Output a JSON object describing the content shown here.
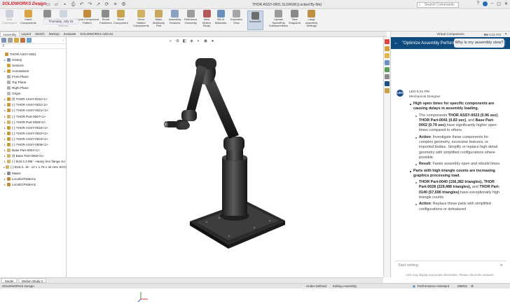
{
  "app": {
    "logo": "SOLIDWORKS Design",
    "doc_title": "THOR ASSY-0001.SLDASM [Locked By Me]",
    "search_placeholder": "Search Commands"
  },
  "title_icons": [
    "home-icon",
    "new-file-icon",
    "open-file-icon",
    "save-icon",
    "print-icon",
    "undo-icon",
    "redo-icon",
    "select-icon",
    "rebuild-icon",
    "file-properties-icon",
    "options-icon"
  ],
  "ribbon": [
    {
      "label": "Edit\nComponent",
      "icon": "edit-component-icon",
      "color": "#9aa9c3",
      "dim": true
    },
    {
      "label": "Insert\nComponents",
      "icon": "insert-components-icon",
      "color": "#d9a441"
    },
    {
      "label": "Mate",
      "icon": "mate-icon",
      "color": "#8d8d8d"
    },
    {
      "label": "Component\nPreview\nWindow",
      "icon": "component-preview-icon",
      "color": "#9fb4cc",
      "dim": true
    },
    {
      "label": "Linear Component\nPattern",
      "icon": "linear-pattern-icon",
      "color": "#c28c3a"
    },
    {
      "label": "Smart\nFasteners",
      "icon": "smart-fasteners-icon",
      "color": "#8b8b8b"
    },
    {
      "label": "Move\nComponent",
      "icon": "move-component-icon",
      "color": "#c9a34b"
    },
    {
      "label": "Show\nHidden\nComponents",
      "icon": "show-hidden-icon",
      "color": "#d2b062"
    },
    {
      "label": "Make\nMultibody\nPart",
      "icon": "multibody-part-icon",
      "color": "#c8a85c"
    },
    {
      "label": "Assembly\nFeatures",
      "icon": "assembly-features-icon",
      "color": "#8aa2c0"
    },
    {
      "label": "Reference\nGeometry",
      "icon": "reference-geometry-icon",
      "color": "#9c9c9c"
    },
    {
      "label": "New\nMotion\nStudy",
      "icon": "motion-study-icon",
      "color": "#b35b5b"
    },
    {
      "label": "Bill of\nMaterials",
      "icon": "bom-icon",
      "color": "#6d8fbf"
    },
    {
      "label": "Exploded\nView",
      "icon": "exploded-view-icon",
      "color": "#a6a6a6"
    },
    {
      "label": "Instant3D",
      "icon": "instant3d-icon",
      "color": "#6d6d6d",
      "active": true
    },
    {
      "label": "Update\nSpeedPak\nSubassemblies",
      "icon": "speedpak-icon",
      "color": "#9b9b9b"
    },
    {
      "label": "Take\nSnapshot",
      "icon": "snapshot-icon",
      "color": "#8a8a8a"
    },
    {
      "label": "Large\nAssembly\nSettings",
      "icon": "large-assembly-icon",
      "color": "#bf8f42"
    }
  ],
  "tabs": [
    "Assembly",
    "Layout",
    "Sketch",
    "Markup",
    "Evaluate",
    "SOLIDWORKS Add-Ins"
  ],
  "feature_tree": [
    {
      "label": "THOR ASSY-0001",
      "indent": 0,
      "arrow": "",
      "color": "#c79b3a"
    },
    {
      "label": "History",
      "indent": 1,
      "arrow": "▸",
      "color": "#7a93b5"
    },
    {
      "label": "Sensors",
      "indent": 1,
      "arrow": "",
      "color": "#d4a030"
    },
    {
      "label": "Annotations",
      "indent": 1,
      "arrow": "▸",
      "color": "#cf9d2a"
    },
    {
      "label": "Front Plane",
      "indent": 1,
      "arrow": "",
      "color": "#b0b0b0"
    },
    {
      "label": "Top Plane",
      "indent": 1,
      "arrow": "",
      "color": "#b0b0b0"
    },
    {
      "label": "Right Plane",
      "indent": 1,
      "arrow": "",
      "color": "#b0b0b0"
    },
    {
      "label": "Origin",
      "indent": 1,
      "arrow": "",
      "color": "#b8b8b8"
    },
    {
      "label": "(f) THOR ASSY-0011<1>",
      "indent": 1,
      "arrow": "▸",
      "color": "#c79b3a"
    },
    {
      "label": "(-) THOR ASSY-0011<2>",
      "indent": 1,
      "arrow": "▸",
      "color": "#c79b3a"
    },
    {
      "label": "(-) THOR ASSY-0021<1>",
      "indent": 1,
      "arrow": "▸",
      "color": "#c79b3a"
    },
    {
      "label": "(-) THOR Part-0007<1>",
      "indent": 1,
      "arrow": "▸",
      "color": "#d3b16a"
    },
    {
      "label": "(-) THOR Part-0050<2>",
      "indent": 1,
      "arrow": "▸",
      "color": "#d3b16a"
    },
    {
      "label": "(-) THOR ASSY-0015<1>",
      "indent": 1,
      "arrow": "▸",
      "color": "#c79b3a"
    },
    {
      "label": "(-) THOR ASSY-0022<1>",
      "indent": 1,
      "arrow": "▸",
      "color": "#c79b3a"
    },
    {
      "label": "(-) THOR ASSY-0023<1>",
      "indent": 1,
      "arrow": "▸",
      "color": "#c79b3a"
    },
    {
      "label": "(-) THOR ASSY-0005<1>",
      "indent": 1,
      "arrow": "▸",
      "color": "#c79b3a"
    },
    {
      "label": "Base Part-0001<1>",
      "indent": 1,
      "arrow": "▸",
      "color": "#d3b16a"
    },
    {
      "label": "(f) Base Part-0002<1>",
      "indent": 1,
      "arrow": "▸",
      "color": "#d3b16a"
    },
    {
      "label": "(-) B18.2.3.9M - Heavy hex flange scr",
      "indent": 1,
      "arrow": "▸",
      "color": "#d3b16a"
    },
    {
      "label": "(-) B18.3...M - 12 x 1.75 x 40 Hex SHCS",
      "indent": 1,
      "arrow": "▸",
      "color": "#d3b16a"
    },
    {
      "label": "Mates",
      "indent": 1,
      "arrow": "▸",
      "color": "#8c8c8c"
    },
    {
      "label": "LocalCirPattern1",
      "indent": 1,
      "arrow": "▸",
      "color": "#c18a3b"
    },
    {
      "label": "LocalCirPattern2",
      "indent": 1,
      "arrow": "▸",
      "color": "#c18a3b"
    }
  ],
  "copilot": {
    "top_title": "Virtual Companions",
    "header_title": "\"Optimize Assembly Performance\"",
    "date": "Thursday, July 31",
    "me_label": "Me",
    "me_time": "5:31 PM",
    "me_message": "Why is my assembly slow?",
    "leo_initials": "LEO",
    "leo_name_time": "LEO  5:31 PM",
    "leo_role": "Mechanical Designer",
    "answer": [
      {
        "type": "pt",
        "bold": true,
        "text": "High open times for specific components are causing delays in assembly loading."
      },
      {
        "type": "sub",
        "rich": [
          {
            "t": "The components "
          },
          {
            "b": "THOR ASSY-0023 (0.96 sec)"
          },
          {
            "t": ", "
          },
          {
            "b": "THOR Part-0041 (0.83 sec)"
          },
          {
            "t": ", and "
          },
          {
            "b": "Base Part-0002 (0.79 sec)"
          },
          {
            "t": " have significantly higher open times compared to others."
          }
        ]
      },
      {
        "type": "sub",
        "rich": [
          {
            "b": "Action"
          },
          {
            "t": ": Investigate these components for complex geometry, excessive features, or imported bodies. Simplify or replace high-detail geometry with simplified configurations where possible."
          }
        ]
      },
      {
        "type": "sub",
        "rich": [
          {
            "b": "Result"
          },
          {
            "t": ": Faster assembly open and rebuild times."
          }
        ]
      },
      {
        "type": "pt",
        "bold": true,
        "text": "Parts with high triangle counts are increasing graphics processing load."
      },
      {
        "type": "sub",
        "rich": [
          {
            "b": "THOR Part-0040 (156,382 triangles), THOR Part-0028 (229,488 triangles), "
          },
          {
            "t": "and "
          },
          {
            "b": "THOR Part-0140 (57,696 triangles)"
          },
          {
            "t": " have exceptionally high triangle counts."
          }
        ]
      },
      {
        "type": "sub",
        "rich": [
          {
            "b": "Action"
          },
          {
            "t": ": Replace these parts with simplified configurations or defeatured"
          }
        ]
      }
    ],
    "input_placeholder": "Start writing",
    "disclaimer": "LEO may display inaccurate information. Please check the answers."
  },
  "bottom_tabs": [
    "Model",
    "Motion Study 1"
  ],
  "status": {
    "left": "SOLIDWORKS Design",
    "under_defined": "Under Defined",
    "editing": "Editing Assembly",
    "assistant": "Performance Assistant",
    "units": "MMGS"
  }
}
